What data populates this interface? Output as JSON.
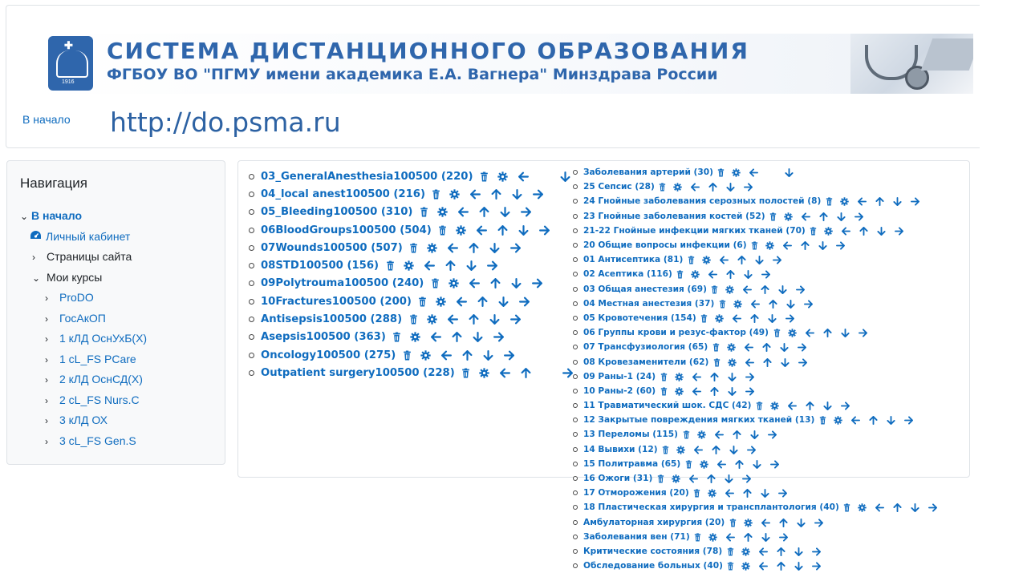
{
  "header": {
    "title": "СИСТЕМА  ДИСТАНЦИОННОГО  ОБРАЗОВАНИЯ",
    "subtitle": "ФГБОУ  ВО  \"ПГМУ  имени академика Е.А. Вагнера\" Минздрава России",
    "logo_year": "1916",
    "home_link": "В начало",
    "site_url": "http://do.psma.ru"
  },
  "navigation": {
    "title": "Навигация",
    "home": "В начало",
    "dashboard": "Личный кабинет",
    "site_pages": "Страницы сайта",
    "my_courses": "Мои курсы",
    "courses": [
      "ProDO",
      "ГосАкОП",
      "1 кЛД ОснУхБ(Х)",
      "1 cL_FS PCare",
      "2 кЛД ОснСД(Х)",
      "2 cL_FS Nurs.C",
      "3 кЛД ОХ",
      "3 cL_FS Gen.S"
    ]
  },
  "question_categories_left": [
    {
      "label": "03_GeneralAnesthesia100500 (220)",
      "actions": [
        "delete",
        "settings",
        "left",
        "spacer",
        "down"
      ]
    },
    {
      "label": "04_local anest100500 (216)",
      "actions": [
        "delete",
        "settings",
        "left",
        "up",
        "down",
        "right"
      ]
    },
    {
      "label": "05_Bleeding100500 (310)",
      "actions": [
        "delete",
        "settings",
        "left",
        "up",
        "down",
        "right"
      ]
    },
    {
      "label": "06BloodGroups100500 (504)",
      "actions": [
        "delete",
        "settings",
        "left",
        "up",
        "down",
        "right"
      ]
    },
    {
      "label": "07Wounds100500 (507)",
      "actions": [
        "delete",
        "settings",
        "left",
        "up",
        "down",
        "right"
      ]
    },
    {
      "label": "08STD100500 (156)",
      "actions": [
        "delete",
        "settings",
        "left",
        "up",
        "down",
        "right"
      ]
    },
    {
      "label": "09Polytrouma100500 (240)",
      "actions": [
        "delete",
        "settings",
        "left",
        "up",
        "down",
        "right"
      ]
    },
    {
      "label": "10Fractures100500 (200)",
      "actions": [
        "delete",
        "settings",
        "left",
        "up",
        "down",
        "right"
      ]
    },
    {
      "label": "Antisepsis100500 (288)",
      "actions": [
        "delete",
        "settings",
        "left",
        "up",
        "down",
        "right"
      ]
    },
    {
      "label": "Asepsis100500 (363)",
      "actions": [
        "delete",
        "settings",
        "left",
        "up",
        "down",
        "right"
      ]
    },
    {
      "label": "Oncology100500 (275)",
      "actions": [
        "delete",
        "settings",
        "left",
        "up",
        "down",
        "right"
      ]
    },
    {
      "label": "Outpatient surgery100500 (228)",
      "actions": [
        "delete",
        "settings",
        "left",
        "up",
        "spacer",
        "right"
      ]
    }
  ],
  "question_categories_right": [
    {
      "label": "Заболевания артерий (30)",
      "actions": [
        "delete",
        "settings",
        "left",
        "spacer",
        "down"
      ]
    },
    {
      "label": "25 Сепсис (28)",
      "actions": [
        "delete",
        "settings",
        "left",
        "up",
        "down",
        "right"
      ]
    },
    {
      "label": "24 Гнойные заболевания серозных полостей (8)",
      "actions": [
        "delete",
        "settings",
        "left",
        "up",
        "down",
        "right"
      ]
    },
    {
      "label": "23 Гнойные заболевания костей (52)",
      "actions": [
        "delete",
        "settings",
        "left",
        "up",
        "down",
        "right"
      ]
    },
    {
      "label": "21-22 Гнойные инфекции мягких тканей (70)",
      "actions": [
        "delete",
        "settings",
        "left",
        "up",
        "down",
        "right"
      ]
    },
    {
      "label": "20 Общие вопросы инфекции (6)",
      "actions": [
        "delete",
        "settings",
        "left",
        "up",
        "down",
        "right"
      ]
    },
    {
      "label": "01 Антисептика (81)",
      "actions": [
        "delete",
        "settings",
        "left",
        "up",
        "down",
        "right"
      ]
    },
    {
      "label": "02 Асептика (116)",
      "actions": [
        "delete",
        "settings",
        "left",
        "up",
        "down",
        "right"
      ]
    },
    {
      "label": "03 Общая анестезия (69)",
      "actions": [
        "delete",
        "settings",
        "left",
        "up",
        "down",
        "right"
      ]
    },
    {
      "label": "04 Местная анестезия (37)",
      "actions": [
        "delete",
        "settings",
        "left",
        "up",
        "down",
        "right"
      ]
    },
    {
      "label": "05 Кровотечения (154)",
      "actions": [
        "delete",
        "settings",
        "left",
        "up",
        "down",
        "right"
      ]
    },
    {
      "label": "06 Группы крови и резус-фактор (49)",
      "actions": [
        "delete",
        "settings",
        "left",
        "up",
        "down",
        "right"
      ]
    },
    {
      "label": "07 Трансфузиология (65)",
      "actions": [
        "delete",
        "settings",
        "left",
        "up",
        "down",
        "right"
      ]
    },
    {
      "label": "08 Кровезаменители (62)",
      "actions": [
        "delete",
        "settings",
        "left",
        "up",
        "down",
        "right"
      ]
    },
    {
      "label": "09 Раны-1 (24)",
      "actions": [
        "delete",
        "settings",
        "left",
        "up",
        "down",
        "right"
      ]
    },
    {
      "label": "10 Раны-2 (60)",
      "actions": [
        "delete",
        "settings",
        "left",
        "up",
        "down",
        "right"
      ]
    },
    {
      "label": "11 Травматический шок. СДС (42)",
      "actions": [
        "delete",
        "settings",
        "left",
        "up",
        "down",
        "right"
      ]
    },
    {
      "label": "12 Закрытые повреждения мягких тканей (13)",
      "actions": [
        "delete",
        "settings",
        "left",
        "up",
        "down",
        "right"
      ]
    },
    {
      "label": "13 Переломы (115)",
      "actions": [
        "delete",
        "settings",
        "left",
        "up",
        "down",
        "right"
      ]
    },
    {
      "label": "14 Вывихи (12)",
      "actions": [
        "delete",
        "settings",
        "left",
        "up",
        "down",
        "right"
      ]
    },
    {
      "label": "15 Политравма (65)",
      "actions": [
        "delete",
        "settings",
        "left",
        "up",
        "down",
        "right"
      ]
    },
    {
      "label": "16 Ожоги (31)",
      "actions": [
        "delete",
        "settings",
        "left",
        "up",
        "down",
        "right"
      ]
    },
    {
      "label": "17 Отморожения (20)",
      "actions": [
        "delete",
        "settings",
        "left",
        "up",
        "down",
        "right"
      ]
    },
    {
      "label": "18 Пластическая хирургия и трансплантология (40)",
      "actions": [
        "delete",
        "settings",
        "left",
        "up",
        "down",
        "right"
      ]
    },
    {
      "label": "Амбулаторная хирургия (20)",
      "actions": [
        "delete",
        "settings",
        "left",
        "up",
        "down",
        "right"
      ]
    },
    {
      "label": "Заболевания вен (71)",
      "actions": [
        "delete",
        "settings",
        "left",
        "up",
        "down",
        "right"
      ]
    },
    {
      "label": "Критические состояния (78)",
      "actions": [
        "delete",
        "settings",
        "left",
        "up",
        "down",
        "right"
      ]
    },
    {
      "label": "Обследование больных (40)",
      "actions": [
        "delete",
        "settings",
        "left",
        "up",
        "down",
        "right"
      ]
    }
  ],
  "colors": {
    "link": "#0f6cbf",
    "banner_text": "#2f66ac",
    "url_text": "#2d62a3"
  }
}
